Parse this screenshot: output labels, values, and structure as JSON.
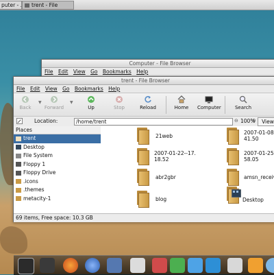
{
  "taskbar": {
    "tasks": [
      {
        "label": "puter - ..."
      },
      {
        "label": "trent - File"
      }
    ]
  },
  "back_window": {
    "title": "Computer - File Browser",
    "menu": [
      "File",
      "Edit",
      "View",
      "Go",
      "Bookmarks",
      "Help"
    ]
  },
  "window": {
    "title": "trent - File Browser",
    "menu": [
      "File",
      "Edit",
      "View",
      "Go",
      "Bookmarks",
      "Help"
    ],
    "toolbar": {
      "back": "Back",
      "forward": "Forward",
      "up": "Up",
      "stop": "Stop",
      "reload": "Reload",
      "home": "Home",
      "computer": "Computer",
      "search": "Search"
    },
    "location": {
      "label": "Location:",
      "value": "/home/trent",
      "zoom": "100%",
      "view_label": "View"
    },
    "places": {
      "header": "Places",
      "items": [
        {
          "label": "trent",
          "selected": true,
          "icon": "home-icon"
        },
        {
          "label": "Desktop",
          "icon": "desktop-icon"
        },
        {
          "label": "File System",
          "icon": "drive-icon"
        },
        {
          "label": "Floppy 1",
          "icon": "floppy-icon"
        },
        {
          "label": "Floppy Drive",
          "icon": "floppy-icon"
        },
        {
          "label": ".icons",
          "icon": "folder-icon"
        },
        {
          "label": ".themes",
          "icon": "folder-icon"
        },
        {
          "label": "metacity-1",
          "icon": "folder-icon"
        }
      ]
    },
    "files": [
      {
        "name1": "21web",
        "name2": ""
      },
      {
        "name1": "2007-01-08-",
        "name2": "41.50"
      },
      {
        "name1": "2007-01-22--17.",
        "name2": "18.52"
      },
      {
        "name1": "2007-01-25-",
        "name2": "58.05"
      },
      {
        "name1": "abr2gbr",
        "name2": ""
      },
      {
        "name1": "amsn_receiv",
        "name2": ""
      },
      {
        "name1": "blog",
        "name2": ""
      },
      {
        "name1": "Desktop",
        "name2": ""
      }
    ],
    "status": "69 items, Free space: 10.3 GB"
  },
  "colors": {
    "selection": "#3a6ea5",
    "folder": "#e0b060"
  }
}
